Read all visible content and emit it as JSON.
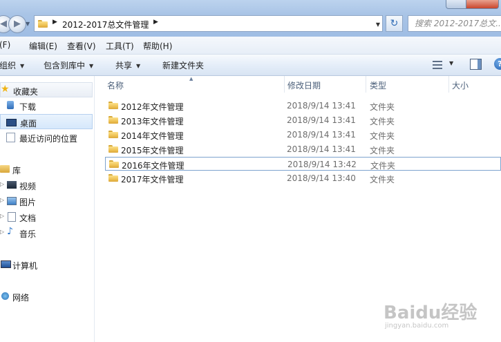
{
  "address_bar": {
    "path": "2012-2017总文件管理",
    "search_placeholder": "搜索 2012-2017总文..."
  },
  "menu": [
    "(F)",
    "编辑(E)",
    "查看(V)",
    "工具(T)",
    "帮助(H)"
  ],
  "toolbar": {
    "organize": "组织",
    "include_in_library": "包含到库中",
    "share": "共享",
    "new_folder": "新建文件夹"
  },
  "sidebar": {
    "favorites": "收藏夹",
    "downloads": "下载",
    "desktop": "桌面",
    "recent": "最近访问的位置",
    "libraries": "库",
    "videos": "视频",
    "pictures": "图片",
    "documents": "文档",
    "music": "音乐",
    "computer": "计算机",
    "network": "网络"
  },
  "columns": {
    "name": "名称",
    "date": "修改日期",
    "type": "类型",
    "size": "大小"
  },
  "files": [
    {
      "name": "2012年文件管理",
      "date": "2018/9/14 13:41",
      "type": "文件夹"
    },
    {
      "name": "2013年文件管理",
      "date": "2018/9/14 13:41",
      "type": "文件夹"
    },
    {
      "name": "2014年文件管理",
      "date": "2018/9/14 13:41",
      "type": "文件夹"
    },
    {
      "name": "2015年文件管理",
      "date": "2018/9/14 13:41",
      "type": "文件夹"
    },
    {
      "name": "2016年文件管理",
      "date": "2018/9/14 13:42",
      "type": "文件夹"
    },
    {
      "name": "2017年文件管理",
      "date": "2018/9/14 13:40",
      "type": "文件夹"
    }
  ],
  "watermark": {
    "brand": "Baidu经验",
    "url": "jingyan.baidu.com"
  },
  "colors": {
    "titlebar": "#a9c4e6",
    "selection_border": "#7da2ce",
    "folder_yellow": "#eec254"
  }
}
